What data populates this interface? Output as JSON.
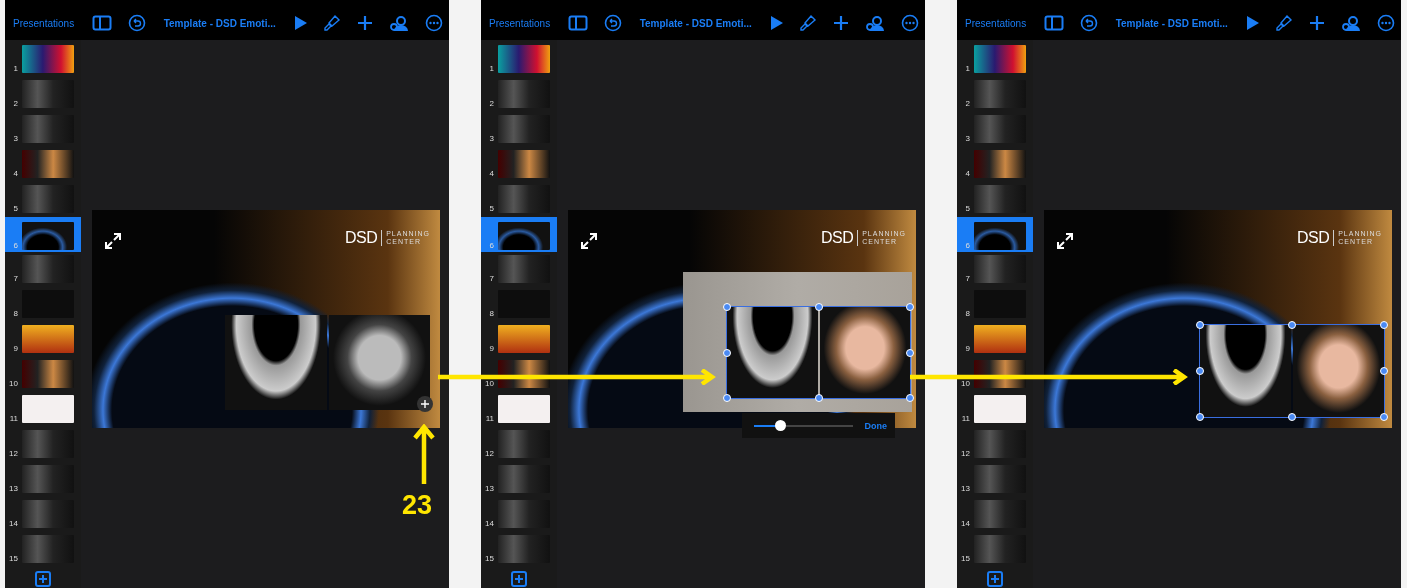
{
  "panels": [
    {
      "toolbar": {
        "back_button": "Presentations",
        "document_title": "Template - DSD Emoti..."
      },
      "slides": [
        {
          "number": "1",
          "selected": false
        },
        {
          "number": "2",
          "selected": false
        },
        {
          "number": "3",
          "selected": false
        },
        {
          "number": "4",
          "selected": false
        },
        {
          "number": "5",
          "selected": false
        },
        {
          "number": "6",
          "selected": true
        },
        {
          "number": "7",
          "selected": false
        },
        {
          "number": "8",
          "selected": false
        },
        {
          "number": "9",
          "selected": false
        },
        {
          "number": "10",
          "selected": false
        },
        {
          "number": "11",
          "selected": false
        },
        {
          "number": "12",
          "selected": false
        },
        {
          "number": "13",
          "selected": false
        },
        {
          "number": "14",
          "selected": false
        },
        {
          "number": "15",
          "selected": false
        }
      ],
      "canvas": {
        "logo": "DSD",
        "logo_line_1": "PLANNING",
        "logo_line_2": "CENTER",
        "kind": "plus"
      }
    },
    {
      "toolbar": {
        "back_button": "Presentations",
        "document_title": "Template - DSD Emoti..."
      },
      "slides": [
        {
          "number": "1",
          "selected": false
        },
        {
          "number": "2",
          "selected": false
        },
        {
          "number": "3",
          "selected": false
        },
        {
          "number": "4",
          "selected": false
        },
        {
          "number": "5",
          "selected": false
        },
        {
          "number": "6",
          "selected": true
        },
        {
          "number": "7",
          "selected": false
        },
        {
          "number": "8",
          "selected": false
        },
        {
          "number": "9",
          "selected": false
        },
        {
          "number": "10",
          "selected": false
        },
        {
          "number": "11",
          "selected": false
        },
        {
          "number": "12",
          "selected": false
        },
        {
          "number": "13",
          "selected": false
        },
        {
          "number": "14",
          "selected": false
        },
        {
          "number": "15",
          "selected": false
        }
      ],
      "canvas": {
        "logo": "DSD",
        "logo_line_1": "PLANNING",
        "logo_line_2": "CENTER",
        "kind": "mask",
        "mask_slider": {
          "level": 0.27,
          "done_button": "Done"
        }
      }
    },
    {
      "toolbar": {
        "back_button": "Presentations",
        "document_title": "Template - DSD Emoti..."
      },
      "slides": [
        {
          "number": "1",
          "selected": false
        },
        {
          "number": "2",
          "selected": false
        },
        {
          "number": "3",
          "selected": false
        },
        {
          "number": "4",
          "selected": false
        },
        {
          "number": "5",
          "selected": false
        },
        {
          "number": "6",
          "selected": true
        },
        {
          "number": "7",
          "selected": false
        },
        {
          "number": "8",
          "selected": false
        },
        {
          "number": "9",
          "selected": false
        },
        {
          "number": "10",
          "selected": false
        },
        {
          "number": "11",
          "selected": false
        },
        {
          "number": "12",
          "selected": false
        },
        {
          "number": "13",
          "selected": false
        },
        {
          "number": "14",
          "selected": false
        },
        {
          "number": "15",
          "selected": false
        }
      ],
      "canvas": {
        "logo": "DSD",
        "logo_line_1": "PLANNING",
        "logo_line_2": "CENTER",
        "kind": "selected"
      }
    }
  ],
  "annotations": {
    "callout_number": "23"
  }
}
